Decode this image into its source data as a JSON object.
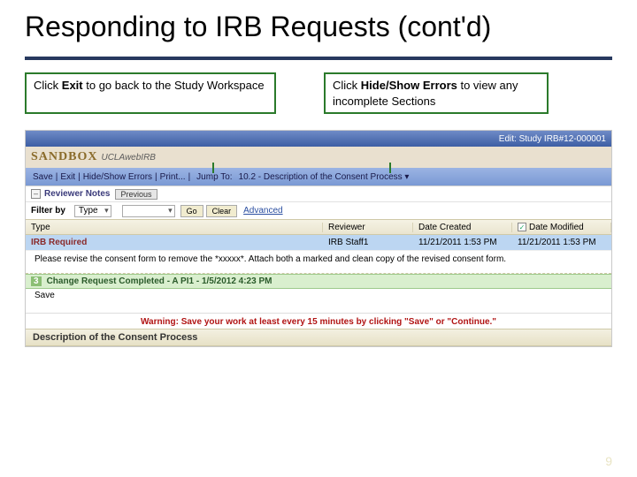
{
  "title": "Responding to IRB Requests (cont'd)",
  "callouts": {
    "left_pre": "Click ",
    "left_bold": "Exit",
    "left_post": " to go back to the Study Workspace",
    "right_pre": "Click ",
    "right_bold": "Hide/Show Errors",
    "right_post": " to view any incomplete Sections"
  },
  "screenshot": {
    "titlebar": "Edit: Study   IRB#12-000001",
    "logo_sand": "SANDBOX",
    "logo_ucla": "UCLAwebIRB",
    "menu": {
      "save": "Save",
      "exit": "Exit",
      "hide": "Hide/Show Errors",
      "print": "Print...",
      "jump": "Jump To:",
      "jump_target": "10.2 - Description of the Consent Process ▾"
    },
    "reviewer_notes": "Reviewer Notes",
    "previous": "Previous",
    "filter": {
      "label": "Filter by",
      "field": "Type",
      "go": "Go",
      "clear": "Clear",
      "adv": "Advanced"
    },
    "columns": {
      "type": "Type",
      "reviewer": "Reviewer",
      "date_created": "Date Created",
      "date_modified": "Date Modified"
    },
    "row": {
      "type": "IRB Required",
      "reviewer": "IRB Staff1",
      "date_created": "11/21/2011 1:53 PM",
      "date_modified": "11/21/2011 1:53 PM"
    },
    "note_text": "Please revise the consent form to remove the *xxxxx*. Attach both a marked and clean copy of the revised consent form.",
    "change_req": "Change Request Completed - A PI1 - 1/5/2012 4:23 PM",
    "change_num": "3",
    "save_word": "Save",
    "warning": "Warning: Save your work at least every 15 minutes by clicking \"Save\" or \"Continue.\"",
    "desc_header": "Description of the Consent Process"
  },
  "page_number": "9"
}
